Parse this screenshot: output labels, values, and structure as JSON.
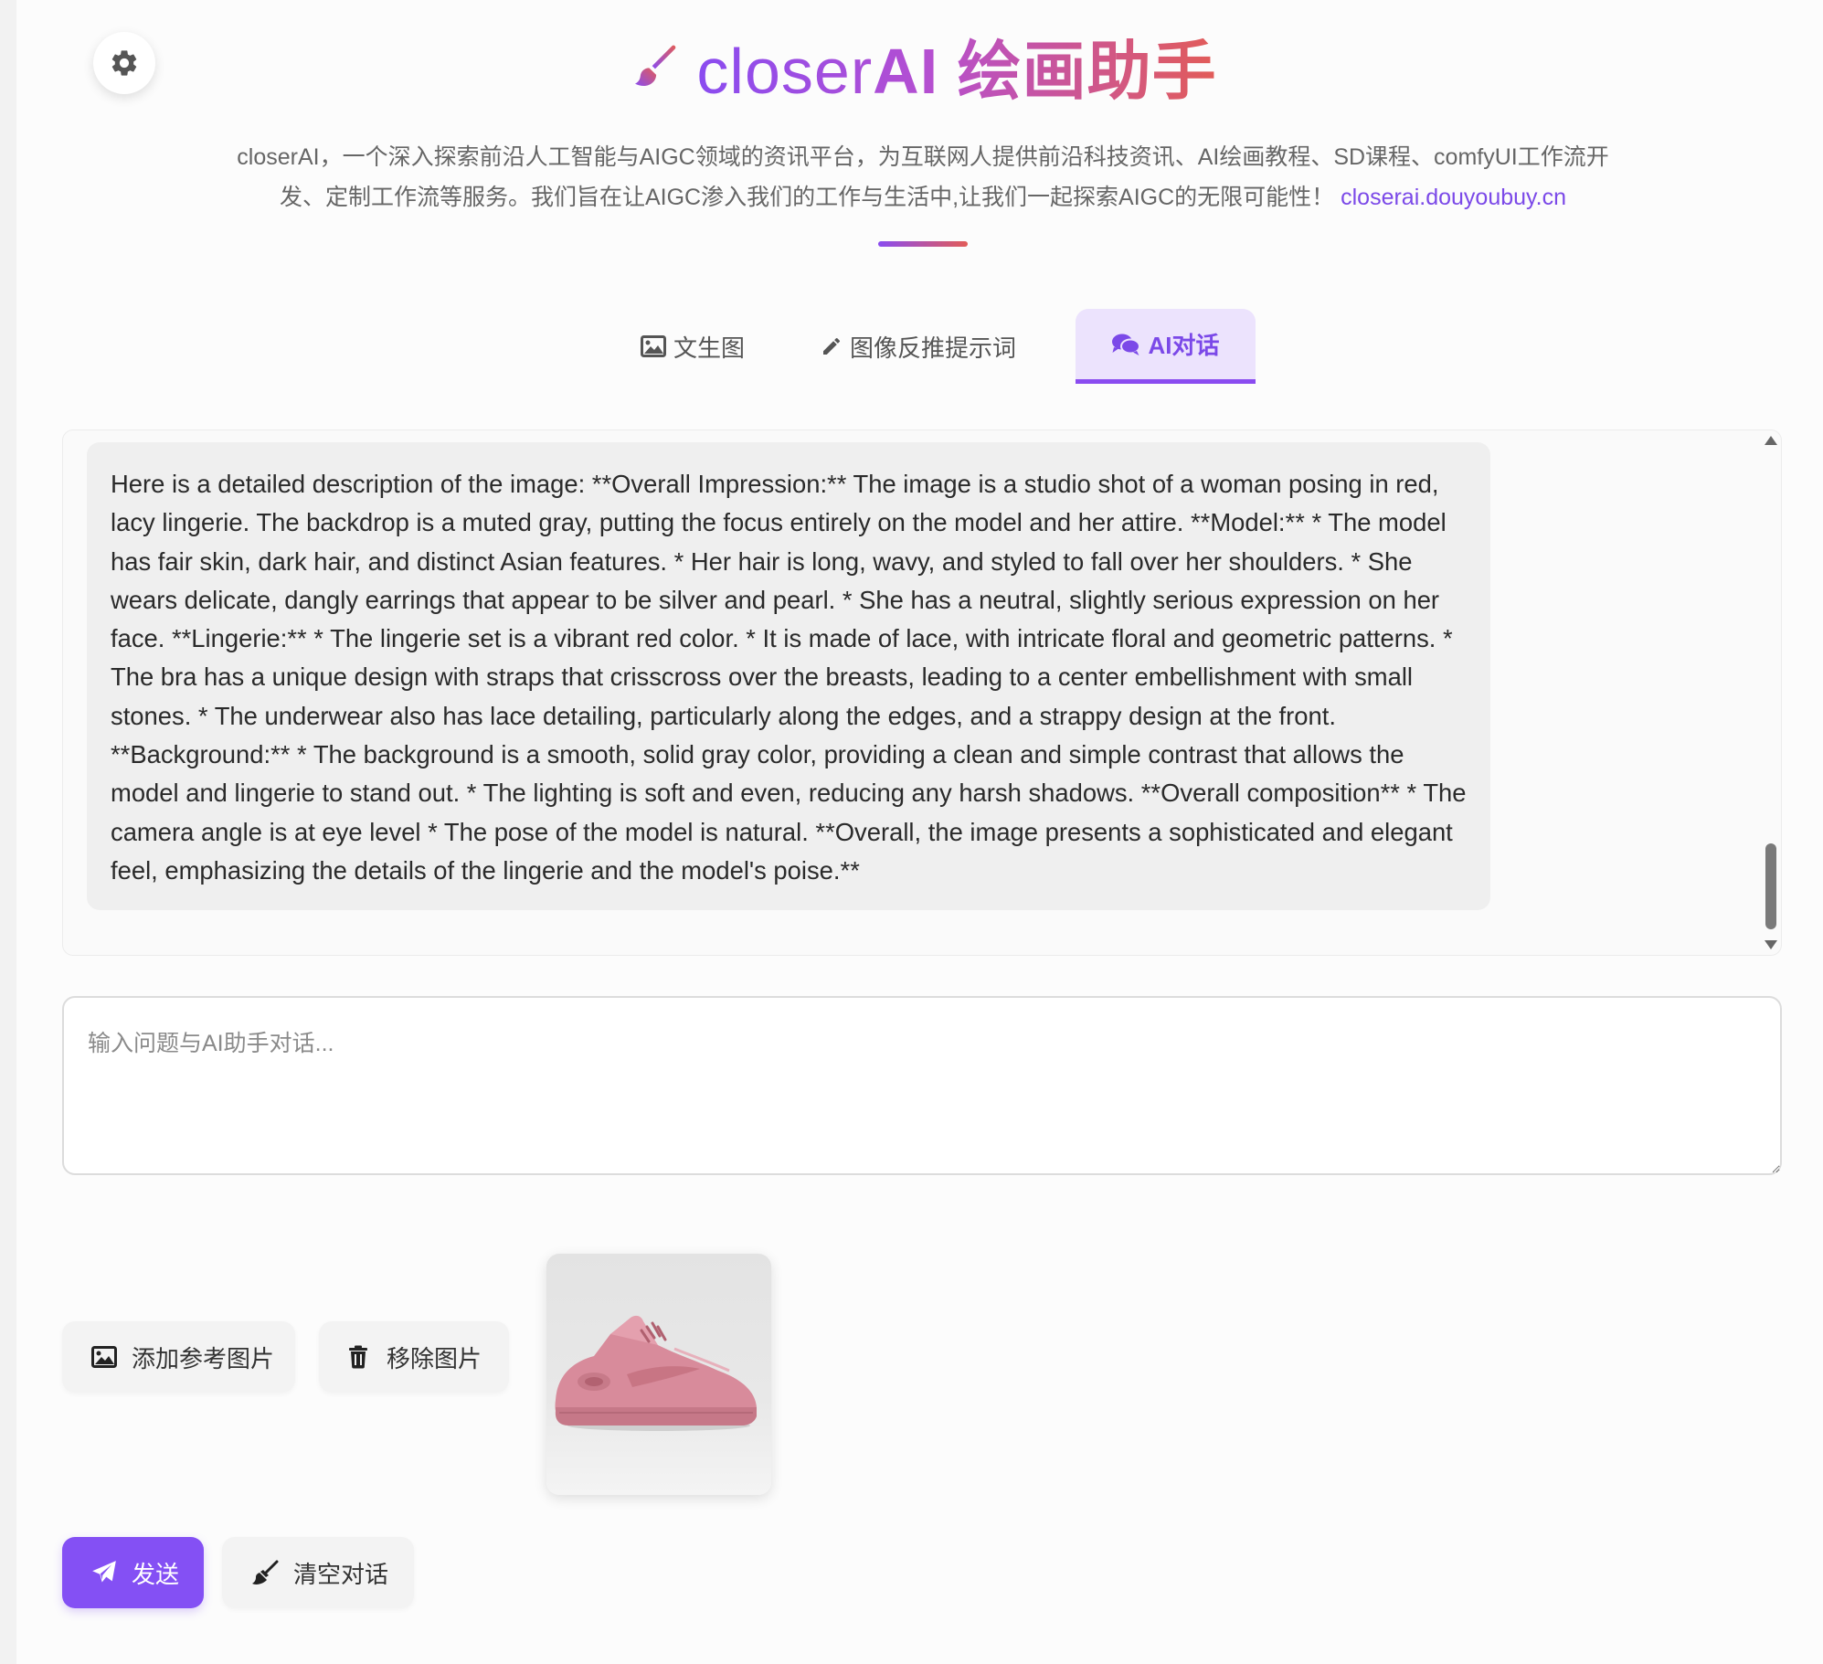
{
  "header": {
    "title_prefix": "closer",
    "title_ai": "AI",
    "title_suffix": " 绘画助手",
    "subtitle": "closerAI，一个深入探索前沿人工智能与AIGC领域的资讯平台，为互联网人提供前沿科技资讯、AI绘画教程、SD课程、comfyUI工作流开发、定制工作流等服务。我们旨在让AIGC渗入我们的工作与生活中,让我们一起探索AIGC的无限可能性！",
    "link": "closerai.douyoubuy.cn"
  },
  "tabs": [
    {
      "label": "文生图",
      "icon": "image-icon"
    },
    {
      "label": "图像反推提示词",
      "icon": "pencil-icon"
    },
    {
      "label": "AI对话",
      "icon": "comments-icon",
      "active": true
    }
  ],
  "chat": {
    "messages": [
      {
        "role": "assistant",
        "text": "Here is a detailed description of the image: **Overall Impression:** The image is a studio shot of a woman posing in red, lacy lingerie. The backdrop is a muted gray, putting the focus entirely on the model and her attire. **Model:** * The model has fair skin, dark hair, and distinct Asian features. * Her hair is long, wavy, and styled to fall over her shoulders. * She wears delicate, dangly earrings that appear to be silver and pearl. * She has a neutral, slightly serious expression on her face. **Lingerie:** * The lingerie set is a vibrant red color. * It is made of lace, with intricate floral and geometric patterns. * The bra has a unique design with straps that crisscross over the breasts, leading to a center embellishment with small stones. * The underwear also has lace detailing, particularly along the edges, and a strappy design at the front. **Background:** * The background is a smooth, solid gray color, providing a clean and simple contrast that allows the model and lingerie to stand out. * The lighting is soft and even, reducing any harsh shadows. **Overall composition** * The camera angle is at eye level * The pose of the model is natural. **Overall, the image presents a sophisticated and elegant feel, emphasizing the details of the lingerie and the model's poise.**"
      }
    ]
  },
  "input": {
    "placeholder": "输入问题与AI助手对话..."
  },
  "buttons": {
    "add_image": "添加参考图片",
    "remove_image": "移除图片",
    "send": "发送",
    "clear": "清空对话"
  },
  "colors": {
    "accent": "#8450f4",
    "title_gradient_start": "#8a4cf0",
    "title_gradient_end": "#e25c58",
    "active_tab_bg": "#ece3fd",
    "sneaker": "#d88b9b"
  }
}
